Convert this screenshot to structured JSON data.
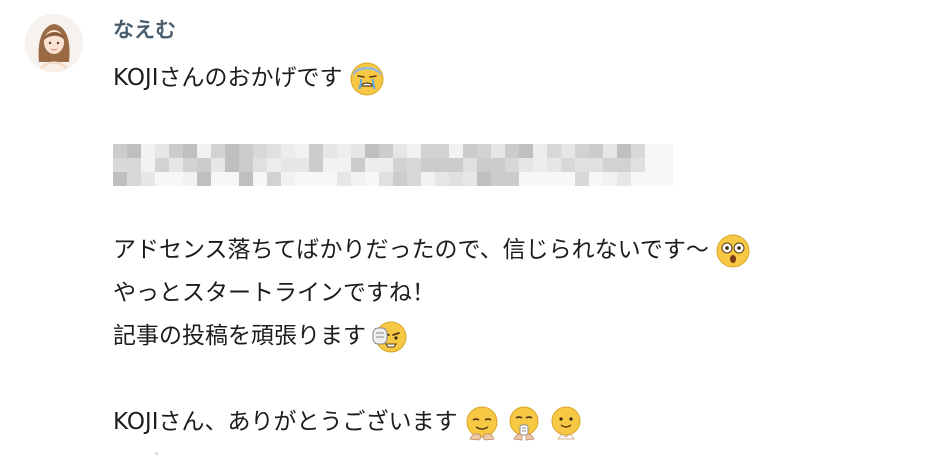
{
  "sender": {
    "name": "なえむ"
  },
  "message": {
    "line1": "KOJIさんのおかげです",
    "line1_emoji": "sweat-crying-face-emoji",
    "redacted": "redacted-pixelated-text",
    "line2": "アドセンス落ちてばかりだったので、信じられないです〜",
    "line2_emoji": "surprised-face-emoji",
    "line3": "やっとスタートラインですね！",
    "line4": "記事の投稿を頑張ります",
    "line4_emoji": "determined-face-emoji",
    "line5": "KOJIさん、ありがとうございます",
    "line5_emojis": [
      "bowing-face-emoji",
      "grateful-face-emoji",
      "smiling-face-emoji"
    ]
  },
  "colors": {
    "sender": "#4a5d6e",
    "text": "#1d1c1d",
    "emoji": "#f7c843"
  }
}
